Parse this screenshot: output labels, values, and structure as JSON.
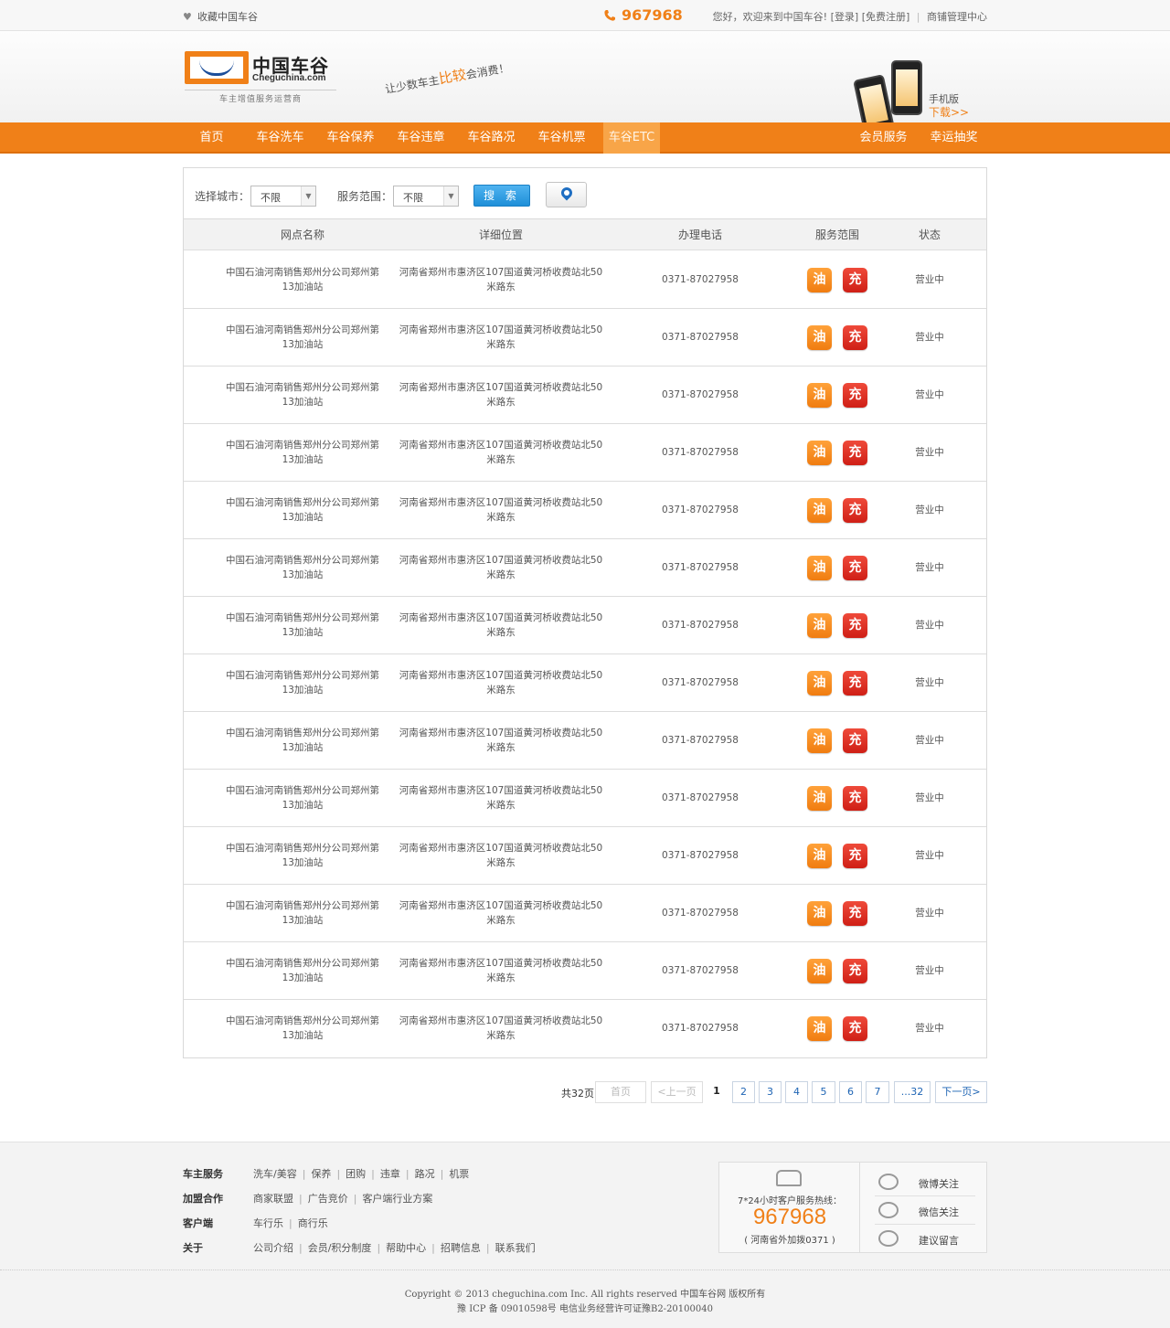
{
  "topbar": {
    "favorite": "收藏中国车谷",
    "hotline": "967968",
    "welcome": "您好，欢迎来到中国车谷!",
    "login": "[登录]",
    "register": "[免费注册]",
    "sep": "|",
    "admin": "商铺管理中心"
  },
  "header": {
    "logo_cn": "中国车谷",
    "logo_en": "Cheguchina.com",
    "logo_tag": "车主增值服务运营商",
    "slogan_pre": "让少数车主",
    "slogan_hl": "比较",
    "slogan_post": "会消费！",
    "mobile_label": "手机版",
    "mobile_download": "下载>>"
  },
  "nav": {
    "items": [
      "首页",
      "车谷洗车",
      "车谷保养",
      "车谷违章",
      "车谷路况",
      "车谷机票",
      "车谷ETC"
    ],
    "right": [
      "会员服务",
      "幸运抽奖"
    ],
    "active": "车谷ETC"
  },
  "filter": {
    "city_label": "选择城市：",
    "city_value": "不限",
    "range_label": "服务范围：",
    "range_value": "不限",
    "search": "搜 索"
  },
  "table": {
    "headers": [
      "网点名称",
      "详细位置",
      "办理电话",
      "服务范围",
      "状态"
    ],
    "rows": [
      {
        "name": "中国石油河南销售郑州分公司郑州第13加油站",
        "addr": "河南省郑州市惠济区107国道黄河桥收费站北50米路东",
        "tel": "0371-87027958",
        "oil": "油",
        "charge": "充",
        "status": "营业中"
      },
      {
        "name": "中国石油河南销售郑州分公司郑州第13加油站",
        "addr": "河南省郑州市惠济区107国道黄河桥收费站北50米路东",
        "tel": "0371-87027958",
        "oil": "油",
        "charge": "充",
        "status": "营业中"
      },
      {
        "name": "中国石油河南销售郑州分公司郑州第13加油站",
        "addr": "河南省郑州市惠济区107国道黄河桥收费站北50米路东",
        "tel": "0371-87027958",
        "oil": "油",
        "charge": "充",
        "status": "营业中"
      },
      {
        "name": "中国石油河南销售郑州分公司郑州第13加油站",
        "addr": "河南省郑州市惠济区107国道黄河桥收费站北50米路东",
        "tel": "0371-87027958",
        "oil": "油",
        "charge": "充",
        "status": "营业中"
      },
      {
        "name": "中国石油河南销售郑州分公司郑州第13加油站",
        "addr": "河南省郑州市惠济区107国道黄河桥收费站北50米路东",
        "tel": "0371-87027958",
        "oil": "油",
        "charge": "充",
        "status": "营业中"
      },
      {
        "name": "中国石油河南销售郑州分公司郑州第13加油站",
        "addr": "河南省郑州市惠济区107国道黄河桥收费站北50米路东",
        "tel": "0371-87027958",
        "oil": "油",
        "charge": "充",
        "status": "营业中"
      },
      {
        "name": "中国石油河南销售郑州分公司郑州第13加油站",
        "addr": "河南省郑州市惠济区107国道黄河桥收费站北50米路东",
        "tel": "0371-87027958",
        "oil": "油",
        "charge": "充",
        "status": "营业中"
      },
      {
        "name": "中国石油河南销售郑州分公司郑州第13加油站",
        "addr": "河南省郑州市惠济区107国道黄河桥收费站北50米路东",
        "tel": "0371-87027958",
        "oil": "油",
        "charge": "充",
        "status": "营业中"
      },
      {
        "name": "中国石油河南销售郑州分公司郑州第13加油站",
        "addr": "河南省郑州市惠济区107国道黄河桥收费站北50米路东",
        "tel": "0371-87027958",
        "oil": "油",
        "charge": "充",
        "status": "营业中"
      },
      {
        "name": "中国石油河南销售郑州分公司郑州第13加油站",
        "addr": "河南省郑州市惠济区107国道黄河桥收费站北50米路东",
        "tel": "0371-87027958",
        "oil": "油",
        "charge": "充",
        "status": "营业中"
      },
      {
        "name": "中国石油河南销售郑州分公司郑州第13加油站",
        "addr": "河南省郑州市惠济区107国道黄河桥收费站北50米路东",
        "tel": "0371-87027958",
        "oil": "油",
        "charge": "充",
        "status": "营业中"
      },
      {
        "name": "中国石油河南销售郑州分公司郑州第13加油站",
        "addr": "河南省郑州市惠济区107国道黄河桥收费站北50米路东",
        "tel": "0371-87027958",
        "oil": "油",
        "charge": "充",
        "status": "营业中"
      },
      {
        "name": "中国石油河南销售郑州分公司郑州第13加油站",
        "addr": "河南省郑州市惠济区107国道黄河桥收费站北50米路东",
        "tel": "0371-87027958",
        "oil": "油",
        "charge": "充",
        "status": "营业中"
      },
      {
        "name": "中国石油河南销售郑州分公司郑州第13加油站",
        "addr": "河南省郑州市惠济区107国道黄河桥收费站北50米路东",
        "tel": "0371-87027958",
        "oil": "油",
        "charge": "充",
        "status": "营业中"
      }
    ]
  },
  "pager": {
    "total": "共32页",
    "first": "首页",
    "prev": "<上一页",
    "current": "1",
    "pages": [
      "2",
      "3",
      "4",
      "5",
      "6",
      "7"
    ],
    "last": "...32",
    "next": "下一页>"
  },
  "footer": {
    "rows": [
      {
        "title": "车主服务",
        "links": [
          "洗车/美容",
          "保养",
          "团购",
          "违章",
          "路况",
          "机票"
        ]
      },
      {
        "title": "加盟合作",
        "links": [
          "商家联盟",
          "广告竞价",
          "客户端行业方案"
        ]
      },
      {
        "title": "客户端",
        "links": [
          "车行乐",
          "商行乐"
        ]
      },
      {
        "title": "关于",
        "links": [
          "公司介绍",
          "会员/积分制度",
          "帮助中心",
          "招聘信息",
          "联系我们"
        ]
      }
    ],
    "service_hot": "7*24小时客户服务热线：",
    "service_num": "967968",
    "service_ext": "( 河南省外加拨0371 )",
    "weibo": "微博关注",
    "weixin": "微信关注",
    "feedback": "建议留言",
    "copyright": "Copyright © 2013 cheguchina.com Inc. All rights reserved 中国车谷网 版权所有",
    "icp": "豫 ICP 备 09010598号 电信业务经营许可证豫B2-20100040"
  }
}
